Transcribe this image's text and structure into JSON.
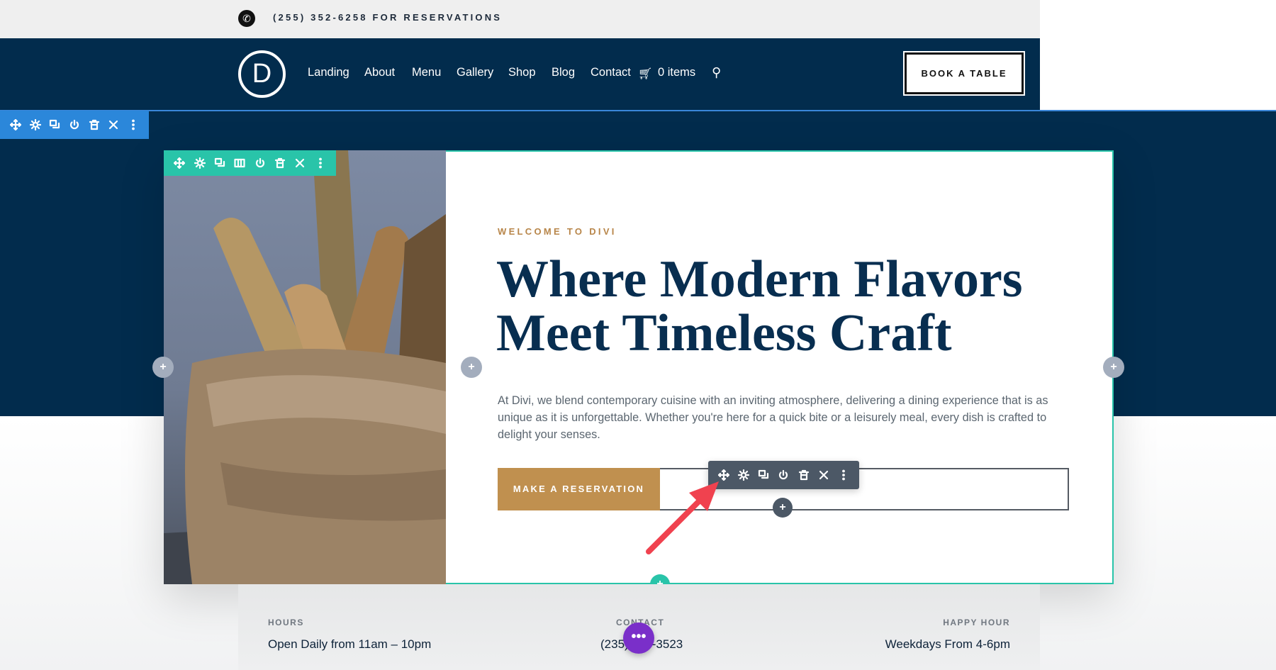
{
  "topbar": {
    "phone_icon": "phone-icon",
    "text": "(255) 352-6258 FOR RESERVATIONS"
  },
  "nav": {
    "logo": "D",
    "links": [
      "Landing",
      "About",
      "Menu",
      "Gallery",
      "Shop",
      "Blog",
      "Contact"
    ],
    "cart": "0 items",
    "cart_icon": "cart-icon",
    "search_icon": "search-icon",
    "cta": "BOOK A TABLE"
  },
  "builder": {
    "row_toolbar": [
      "move-icon",
      "gear-icon",
      "duplicate-icon",
      "power-icon",
      "trash-icon",
      "close-icon",
      "more-icon"
    ],
    "column_toolbar": [
      "move-icon",
      "gear-icon",
      "duplicate-icon",
      "columns-icon",
      "power-icon",
      "trash-icon",
      "close-icon",
      "more-icon"
    ],
    "module_toolbar": [
      "move-icon",
      "gear-icon",
      "duplicate-icon",
      "power-icon",
      "trash-icon",
      "close-icon",
      "more-icon"
    ],
    "plus": "+",
    "more": "•••",
    "colors": {
      "row": "#2b87da",
      "column": "#29c4a9",
      "module": "#4c5866",
      "fab": "#7a2fc9",
      "arrow": "#f0424f"
    }
  },
  "hero": {
    "eyebrow": "WELCOME TO DIVI",
    "title_line1": "Where Modern Flavors",
    "title_line2": "Meet Timeless Craft",
    "body": "At Divi, we blend contemporary cuisine with an inviting atmosphere, delivering a dining experience that is as unique as it is unforgettable. Whether you're here for a quick bite or a leisurely meal, every dish is crafted to delight your senses.",
    "button": "MAKE A RESERVATION"
  },
  "info": {
    "hours": {
      "label": "HOURS",
      "value": "Open Daily from 11am – 10pm"
    },
    "contact": {
      "label": "CONTACT",
      "value": "(235) 235-3523"
    },
    "happy": {
      "label": "HAPPY HOUR",
      "value": "Weekdays From 4-6pm"
    }
  }
}
